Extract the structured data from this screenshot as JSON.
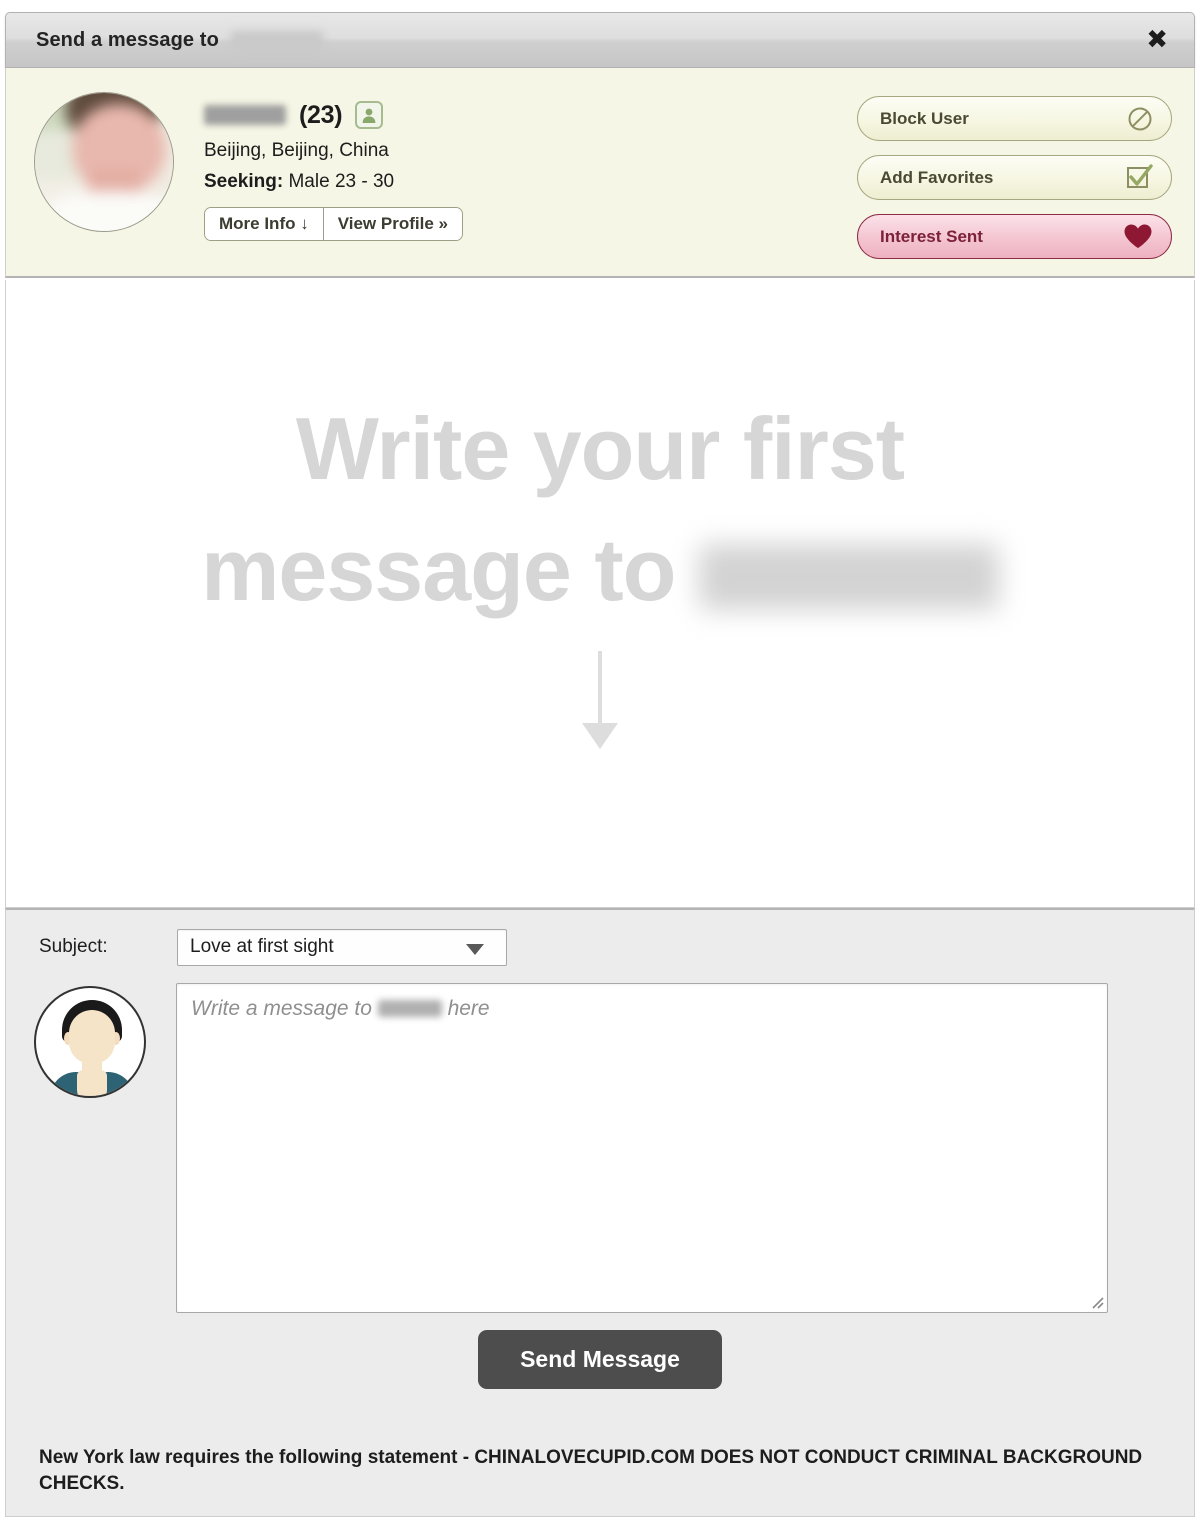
{
  "window": {
    "title": "Send a message to",
    "title_name_redacted": true,
    "close_label": "✖",
    "close_icon": "close-icon"
  },
  "profile": {
    "photo_redacted": true,
    "name_redacted": true,
    "age": "(23)",
    "verified_icon": "person-badge-icon",
    "location": "Beijing, Beijing, China",
    "seeking_label": "Seeking:",
    "seeking_value": "Male 23 - 30",
    "more_info_label": "More Info ↓",
    "view_profile_label": "View Profile »"
  },
  "actions": [
    {
      "label": "Block User",
      "icon": "block-icon",
      "style": "green"
    },
    {
      "label": "Add Favorites",
      "icon": "checkbox-check-icon",
      "style": "green"
    },
    {
      "label": "Interest Sent",
      "icon": "heart-icon",
      "style": "pink"
    }
  ],
  "watermark": {
    "line1": "Write your first",
    "line2": "message to",
    "name_redacted": true,
    "arrow_icon": "down-arrow-icon"
  },
  "compose": {
    "subject_label": "Subject:",
    "subject_value": "Love at first sight",
    "subject_options": [
      "Love at first sight"
    ],
    "dropdown_icon": "chevron-down-icon",
    "my_avatar_icon": "default-user-avatar",
    "message_value": "",
    "message_placeholder_before": "Write a message to ",
    "message_placeholder_after": " here",
    "resize_grip_icon": "resize-grip-icon",
    "send_label": "Send Message"
  },
  "legal": {
    "text": "New York law requires the following statement - CHINALOVECUPID.COM DOES NOT CONDUCT CRIMINAL BACKGROUND CHECKS."
  },
  "colors": {
    "titlebar": "#dedede",
    "profile_strip": "#f6f6e6",
    "compose_bg": "#ececec",
    "accent_green": "#a7a77f",
    "accent_pink": "#8d2a44",
    "send_button": "#4d4d4d",
    "watermark_text": "#d6d6d6"
  }
}
